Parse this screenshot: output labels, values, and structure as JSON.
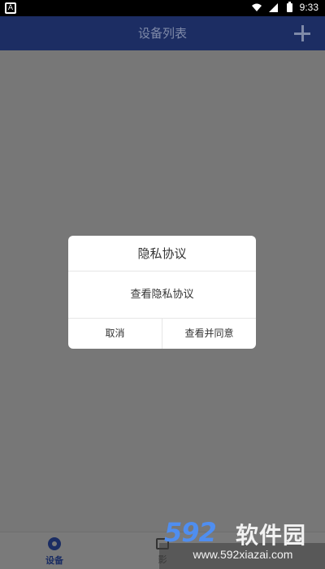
{
  "status_bar": {
    "time": "9:33",
    "icons": [
      "notification-a-icon",
      "wifi-icon",
      "signal-icon",
      "battery-icon"
    ]
  },
  "app_bar": {
    "title": "设备列表",
    "add_icon": "plus-icon"
  },
  "dialog": {
    "title": "隐私协议",
    "message": "查看隐私协议",
    "cancel_label": "取消",
    "confirm_label": "查看并同意"
  },
  "bottom_nav": {
    "items": [
      {
        "label": "设备",
        "icon": "camera-icon",
        "active": true
      },
      {
        "label": "影",
        "icon": "media-icon",
        "active": false
      }
    ]
  },
  "watermark": {
    "logo_number": "592",
    "logo_text": "软件园",
    "url": "www.592xiazai.com"
  },
  "colors": {
    "app_bar": "#1c2d63",
    "overlay": "#777777",
    "accent": "#1b2d63",
    "watermark_blue": "#4f8ef0"
  }
}
